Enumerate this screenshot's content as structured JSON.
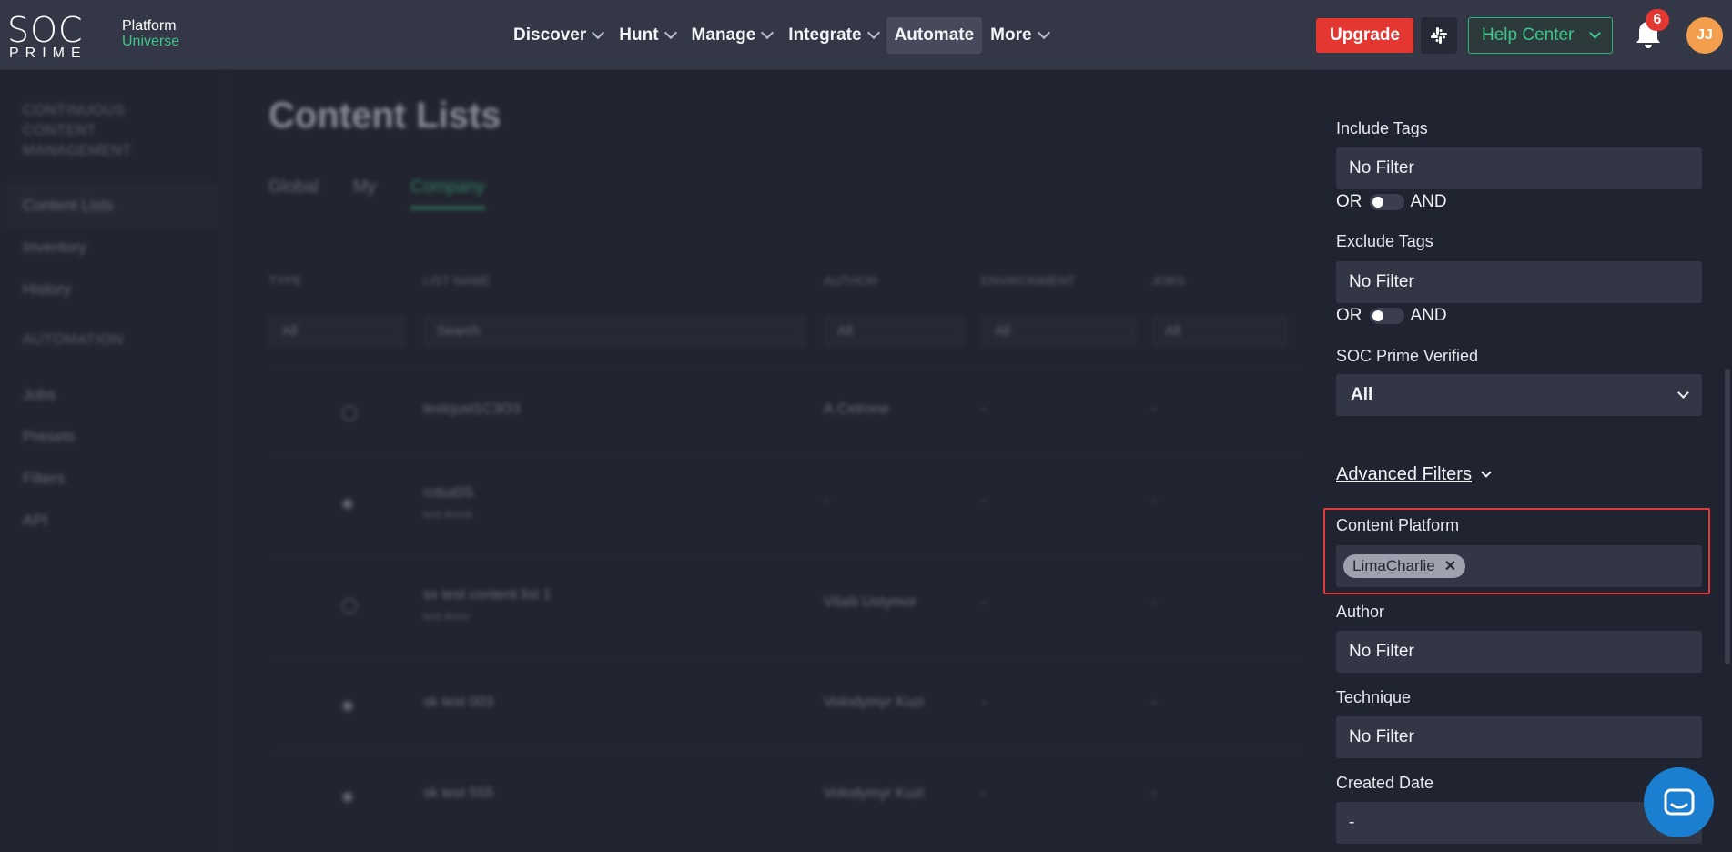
{
  "brand": {
    "logo_top": "SOC",
    "logo_bottom": "PRIME",
    "platform": "Platform",
    "universe": "Universe"
  },
  "nav": [
    {
      "label": "Discover",
      "dropdown": true
    },
    {
      "label": "Hunt",
      "dropdown": true
    },
    {
      "label": "Manage",
      "dropdown": true
    },
    {
      "label": "Integrate",
      "dropdown": true
    },
    {
      "label": "Automate",
      "dropdown": false,
      "active": true
    },
    {
      "label": "More",
      "dropdown": true
    }
  ],
  "header": {
    "upgrade_label": "Upgrade",
    "help_label": "Help Center",
    "notification_count": "6",
    "avatar_initials": "JJ",
    "slack_icon": "slack-icon"
  },
  "colors": {
    "accent": "#3fc58a",
    "danger": "#e53731",
    "highlight": "#e0393c",
    "avatar": "#f29e4c",
    "chat": "#1a7fd0"
  },
  "background_page": {
    "sidebar": {
      "group1": "CONTINUOUS CONTENT MANAGEMENT",
      "items1": [
        "Content Lists",
        "Inventory",
        "History"
      ],
      "group2": "AUTOMATION",
      "items2": [
        "Jobs",
        "Presets",
        "Filters",
        "API"
      ]
    },
    "title": "Content Lists",
    "tabs": [
      "Global",
      "My",
      "Company"
    ],
    "columns": [
      "TYPE",
      "LIST NAME",
      "AUTHOR",
      "ENVIRONMENT",
      "JOBS"
    ],
    "filter_values": [
      "All",
      "Search",
      "All",
      "All",
      "All"
    ],
    "rows": [
      {
        "name": "testrjust1C3O3",
        "sub": "",
        "author": "A.Cetrone",
        "env": "-",
        "jobs": "-"
      },
      {
        "name": "rcttut0S",
        "sub": "test desck",
        "author": "-",
        "env": "-",
        "jobs": "-"
      },
      {
        "name": "ss test content list 1",
        "sub": "test descr",
        "author": "Vitalii Ustymor",
        "env": "-",
        "jobs": "-"
      },
      {
        "name": "sk test 003",
        "sub": "",
        "author": "Volodymyr Kuzi",
        "env": "-",
        "jobs": "-"
      },
      {
        "name": "sk test 555",
        "sub": "",
        "author": "Volodymyr Kuzi",
        "env": "-",
        "jobs": "-"
      }
    ]
  },
  "panel": {
    "include_tags": {
      "label": "Include Tags",
      "value": "No Filter"
    },
    "include_toggle": {
      "left": "OR",
      "right": "AND"
    },
    "exclude_tags": {
      "label": "Exclude Tags",
      "value": "No Filter"
    },
    "exclude_toggle": {
      "left": "OR",
      "right": "AND"
    },
    "verified": {
      "label": "SOC Prime Verified",
      "value": "All"
    },
    "advanced_label": "Advanced Filters",
    "content_platform": {
      "label": "Content Platform",
      "chip": "LimaCharlie"
    },
    "author": {
      "label": "Author",
      "value": "No Filter"
    },
    "technique": {
      "label": "Technique",
      "value": "No Filter"
    },
    "created_date": {
      "label": "Created Date",
      "value": "-"
    }
  }
}
